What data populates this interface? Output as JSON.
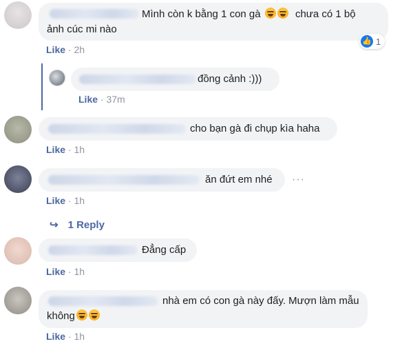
{
  "comments": [
    {
      "text": "Mình còn k bằng 1 con gà",
      "text_after": "chưa có 1 bộ",
      "text_line2": "ảnh cúc mi nào",
      "like": "Like",
      "time": "2h",
      "reaction_count": "1"
    },
    {
      "text": "đồng cảnh :)))",
      "like": "Like",
      "time": "37m"
    },
    {
      "text": "cho bạn gà đi chụp kìa haha",
      "like": "Like",
      "time": "1h"
    },
    {
      "text": "ăn đứt em nhé",
      "like": "Like",
      "time": "1h",
      "more": "···"
    },
    {
      "text": "Đẳng cấp",
      "like": "Like",
      "time": "1h"
    },
    {
      "text": "nhà em có con gà này đấy. Mượn làm mẫu",
      "text_line2": "không",
      "like": "Like",
      "time": "1h"
    }
  ],
  "replies_link": {
    "label": "1 Reply"
  },
  "separator": "·",
  "icons": [
    "laughing-emoji-icon",
    "thumbs-up-reaction-icon",
    "reply-arrow-icon",
    "more-options-icon"
  ],
  "colors": {
    "like_link": "#4b67a1",
    "bubble_bg": "#f2f3f5",
    "meta_gray": "#90949c",
    "reaction_blue": "#1877f2",
    "thread_line": "#4b67a1"
  }
}
